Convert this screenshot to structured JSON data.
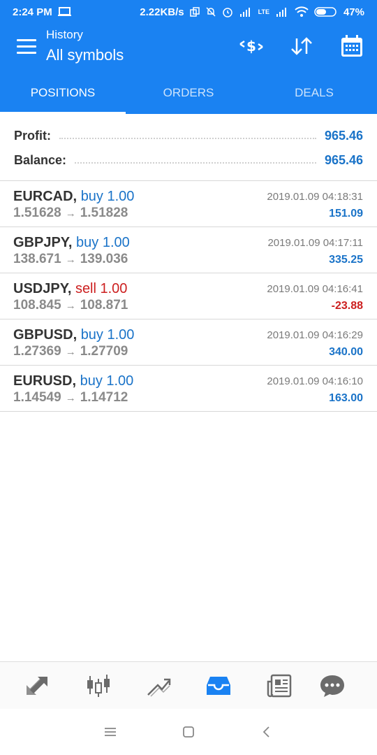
{
  "status_bar": {
    "time": "2:24 PM",
    "speed": "2.22KB/s",
    "lte_label": "LTE",
    "battery": "47%"
  },
  "app_bar": {
    "subtitle": "History",
    "title": "All symbols"
  },
  "tabs": [
    {
      "label": "POSITIONS",
      "active": true
    },
    {
      "label": "ORDERS",
      "active": false
    },
    {
      "label": "DEALS",
      "active": false
    }
  ],
  "summary": {
    "profit_label": "Profit:",
    "profit_value": "965.46",
    "balance_label": "Balance:",
    "balance_value": "965.46"
  },
  "trades": [
    {
      "symbol": "EURCAD,",
      "side": "buy 1.00",
      "open": "1.51628",
      "close": "1.51828",
      "time": "2019.01.09 04:18:31",
      "profit": "151.09"
    },
    {
      "symbol": "GBPJPY,",
      "side": "buy 1.00",
      "open": "138.671",
      "close": "139.036",
      "time": "2019.01.09 04:17:11",
      "profit": "335.25"
    },
    {
      "symbol": "USDJPY,",
      "side": "sell 1.00",
      "open": "108.845",
      "close": "108.871",
      "time": "2019.01.09 04:16:41",
      "profit": "-23.88"
    },
    {
      "symbol": "GBPUSD,",
      "side": "buy 1.00",
      "open": "1.27369",
      "close": "1.27709",
      "time": "2019.01.09 04:16:29",
      "profit": "340.00"
    },
    {
      "symbol": "EURUSD,",
      "side": "buy 1.00",
      "open": "1.14549",
      "close": "1.14712",
      "time": "2019.01.09 04:16:10",
      "profit": "163.00"
    }
  ],
  "arrow_glyph": "→",
  "colors": {
    "header_blue": "#1a82f2",
    "value_blue": "#1a73c8",
    "loss_red": "#cc1f1f"
  },
  "icons": {
    "bottom_nav": [
      "quotes-icon",
      "chart-candles-icon",
      "trade-icon",
      "history-inbox-icon",
      "news-icon",
      "chat-icon"
    ],
    "actions": [
      "currency-filter-icon",
      "sort-icon",
      "calendar-icon"
    ]
  }
}
